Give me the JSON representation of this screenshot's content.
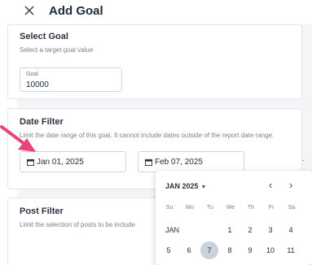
{
  "header": {
    "title": "Add Goal"
  },
  "select_goal": {
    "title": "Select Goal",
    "subtitle": "Select a target goal value",
    "field_label": "Goal",
    "field_value": "10000"
  },
  "date_filter": {
    "title": "Date Filter",
    "subtitle": "Limit the date range of this goal. It cannot include dates outside of the report date range.",
    "start_date": "Jan 01, 2025",
    "end_date": "Feb 07, 2025"
  },
  "post_filter": {
    "title": "Post Filter",
    "subtitle": "Limit the selection of posts to be include"
  },
  "calendar": {
    "month_label": "JAN 2025",
    "weekdays": [
      "Su",
      "Mo",
      "Tu",
      "We",
      "Th",
      "Fr",
      "Sa"
    ],
    "row_month": "JAN",
    "row1": [
      "1",
      "2",
      "3",
      "4"
    ],
    "row2": [
      "5",
      "6",
      "7",
      "8",
      "9",
      "10",
      "11"
    ],
    "selected_day": "7"
  },
  "colors": {
    "accent_arrow": "#e8457a",
    "selected_day_bg": "#c8d1dc"
  }
}
